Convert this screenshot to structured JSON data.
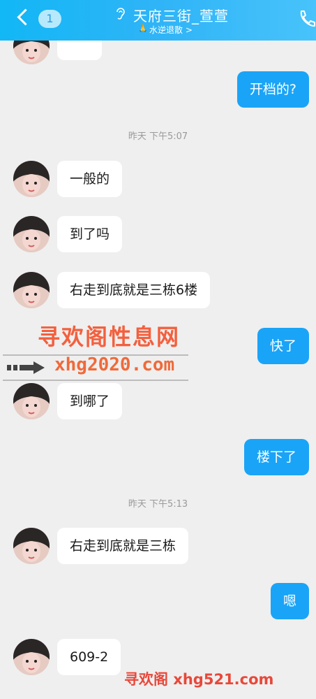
{
  "header": {
    "unread_count": "1",
    "title": "天府三街_萱萱",
    "subtitle": "水逆退散 >"
  },
  "messages": [
    {
      "side": "out",
      "text": "开档的?"
    },
    {
      "type": "time",
      "text": "昨天 下午5:07"
    },
    {
      "side": "in",
      "text": "一般的"
    },
    {
      "side": "in",
      "text": "到了吗"
    },
    {
      "side": "in",
      "text": "右走到底就是三栋6楼"
    },
    {
      "side": "out",
      "text": "快了"
    },
    {
      "side": "in",
      "text": "到哪了"
    },
    {
      "side": "out",
      "text": "楼下了"
    },
    {
      "type": "time",
      "text": "昨天 下午5:13"
    },
    {
      "side": "in",
      "text": "右走到底就是三栋"
    },
    {
      "side": "out",
      "text": "嗯"
    },
    {
      "side": "in",
      "text": "609-2"
    }
  ],
  "watermarks": {
    "line1": "寻欢阁性息网",
    "line2": "xhg2020.com",
    "bottom": "寻欢阁 xhg521.com"
  },
  "colors": {
    "header": "#2fb4f7",
    "outgoing_bubble": "#1aa4f7",
    "incoming_bubble": "#ffffff",
    "background": "#efefef",
    "watermark": "#f3603e"
  },
  "icons": [
    "back-chevron-icon",
    "ear-icon",
    "praying-hands-icon",
    "phone-icon",
    "arrow-icon"
  ]
}
